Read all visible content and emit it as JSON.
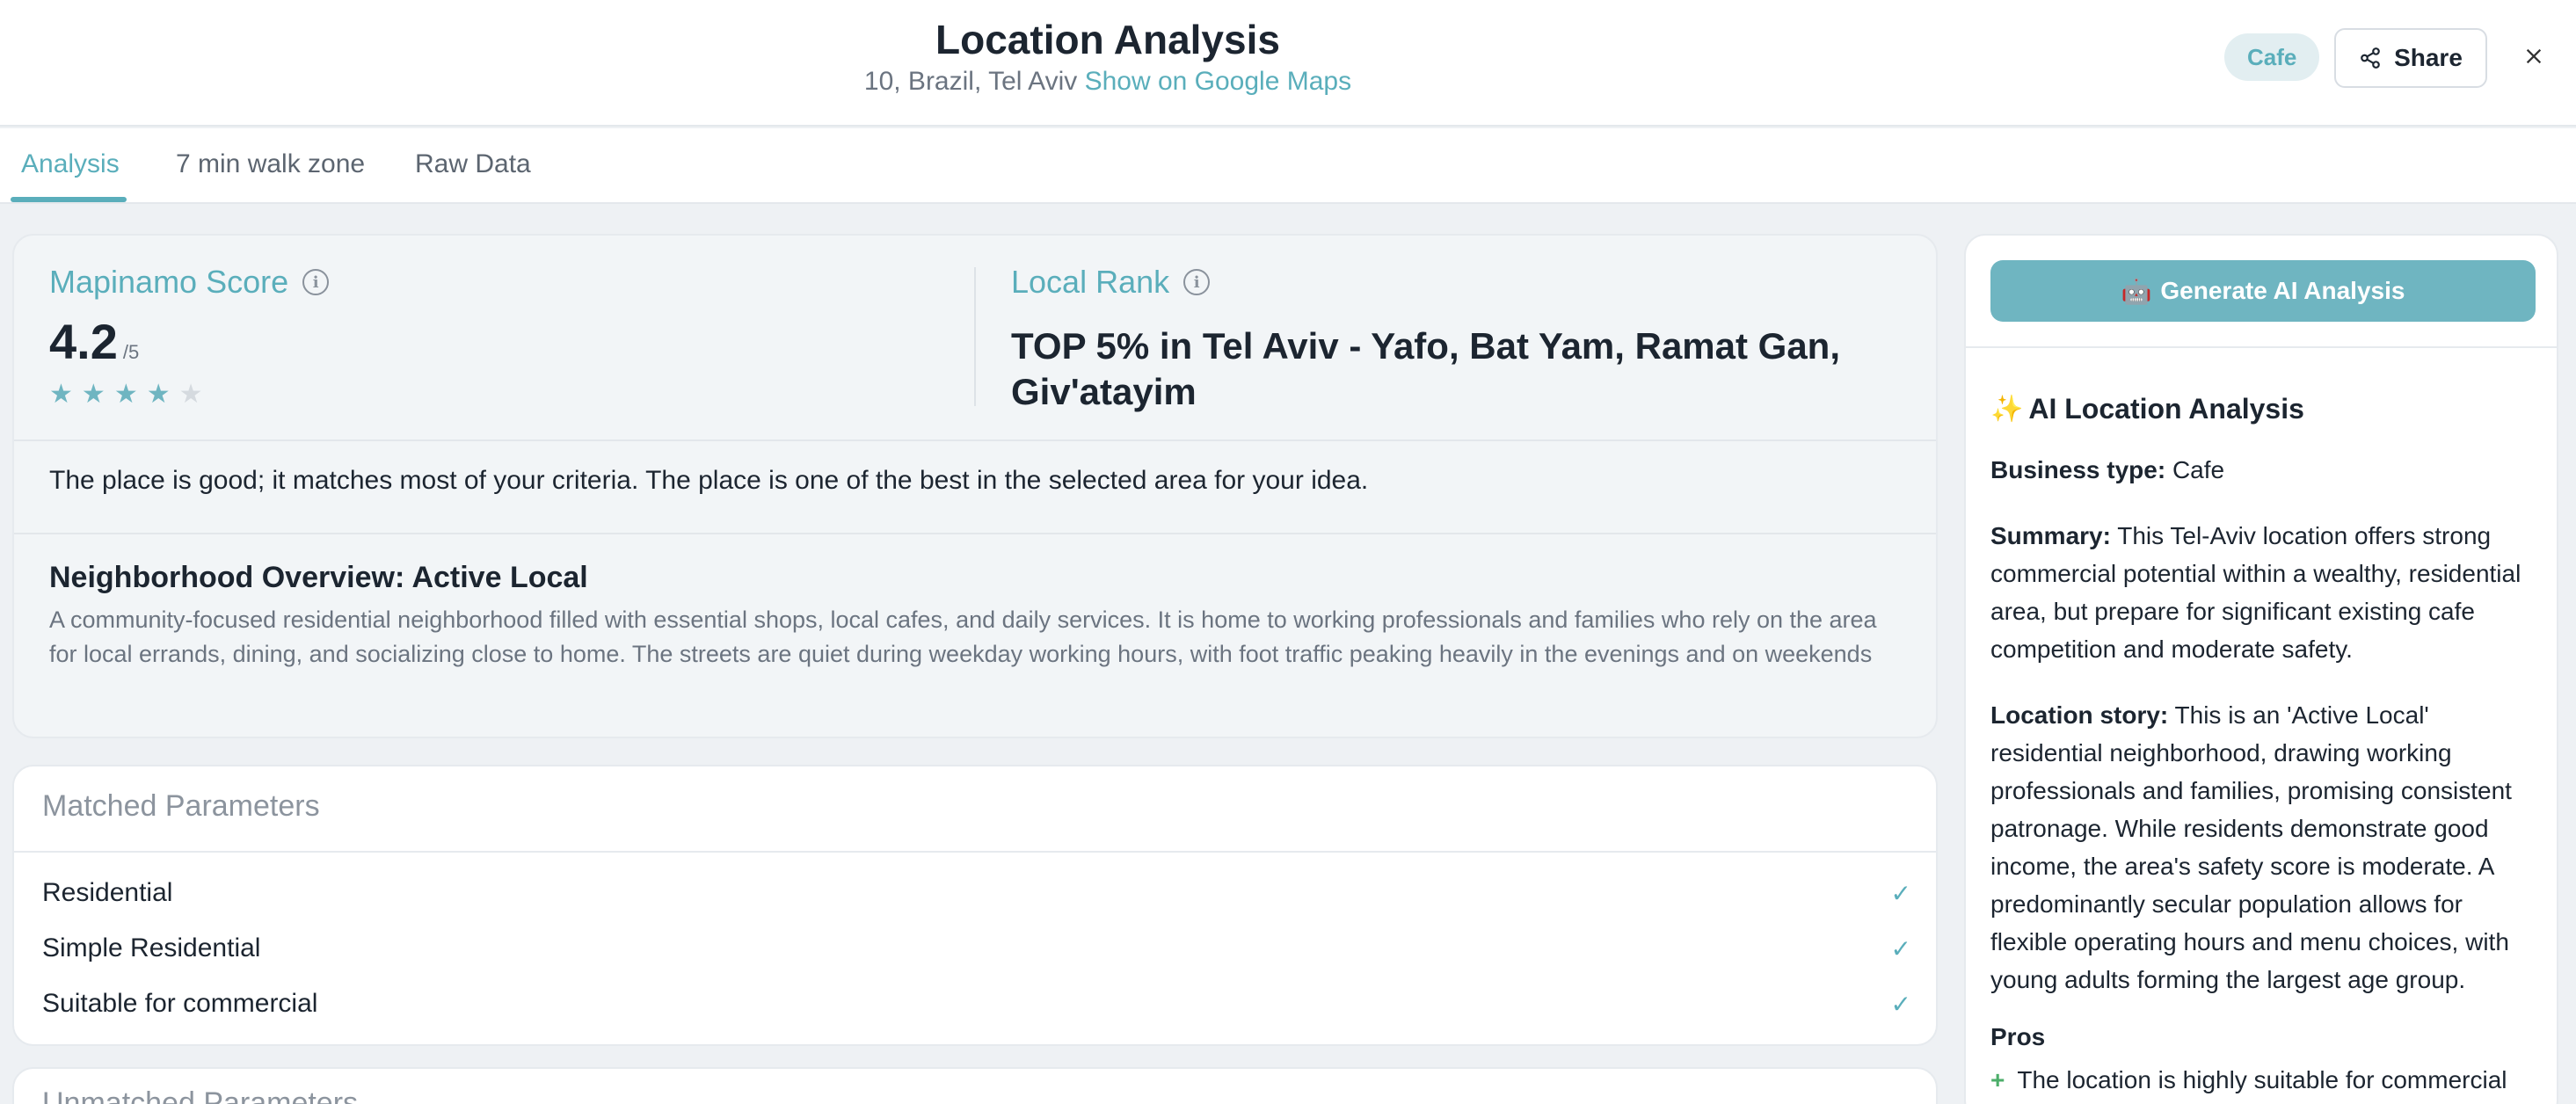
{
  "header": {
    "title": "Location Analysis",
    "address": "10, Brazil, Tel Aviv",
    "maps_link": "Show on Google Maps",
    "tag": "Cafe",
    "share_label": "Share",
    "share_icon": "share-icon",
    "close_icon": "close-icon"
  },
  "tabs": [
    {
      "label": "Analysis",
      "active": true
    },
    {
      "label": "7 min walk zone",
      "active": false
    },
    {
      "label": "Raw Data",
      "active": false
    }
  ],
  "score": {
    "label": "Mapinamo Score",
    "value": "4.2",
    "max": "/5",
    "stars_filled": 4,
    "stars_total": 5
  },
  "rank": {
    "label": "Local Rank",
    "text": "TOP 5% in Tel Aviv - Yafo, Bat Yam, Ramat Gan, Giv'atayim"
  },
  "summary": "The place is good; it matches most of your criteria. The place is one of the best in the selected area for your idea.",
  "neighborhood": {
    "title": "Neighborhood Overview: Active Local",
    "description": "A community-focused residential neighborhood filled with essential shops, local cafes, and daily services. It is home to working professionals and families who rely on the area for local errands, dining, and socializing close to home. The streets are quiet during weekday working hours, with foot traffic peaking heavily in the evenings and on weekends"
  },
  "matched": {
    "title": "Matched Parameters",
    "items": [
      "Residential",
      "Simple Residential",
      "Suitable for commercial"
    ]
  },
  "unmatched": {
    "title": "Unmatched Parameters"
  },
  "ai": {
    "button_label": "Generate AI Analysis",
    "button_icon": "🤖",
    "heading_icon": "✨",
    "heading": "AI Location Analysis",
    "business_type_label": "Business type:",
    "business_type": "Cafe",
    "summary_label": "Summary:",
    "summary": "This Tel-Aviv location offers strong commercial potential within a wealthy, residential area, but prepare for significant existing cafe competition and moderate safety.",
    "story_label": "Location story:",
    "story": "This is an 'Active Local' residential neighborhood, drawing working professionals and families, promising consistent patronage. While residents demonstrate good income, the area's safety score is moderate. A predominantly secular population allows for flexible operating hours and menu choices, with young adults forming the largest age group.",
    "pros_title": "Pros",
    "pros": [
      "The location is highly suitable for commercial"
    ]
  },
  "colors": {
    "accent": "#5aaebb",
    "button": "#6fb5c1",
    "text": "#1c2530",
    "muted": "#6b7480"
  }
}
